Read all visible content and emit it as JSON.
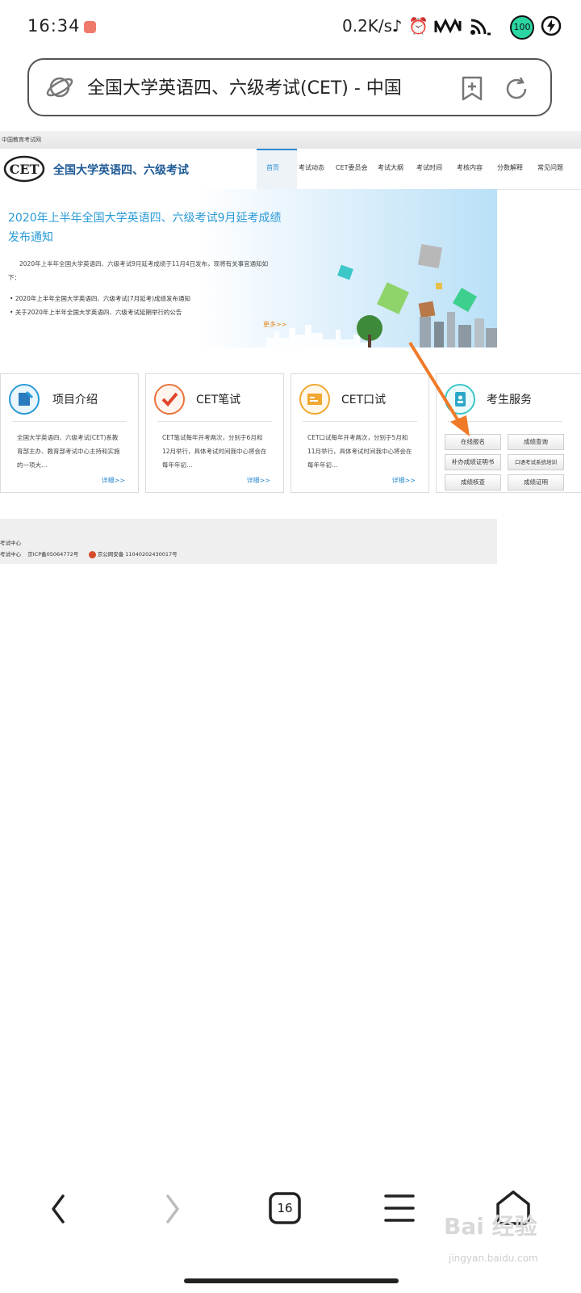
{
  "status_bar": {
    "time": "16:34",
    "net_speed": "0.2K/s",
    "battery": "100"
  },
  "browser": {
    "address_title": "全国大学英语四、六级考试(CET) - 中国",
    "tab_count": "16"
  },
  "site": {
    "top_label": "中国教育考试网",
    "logo_text": "CET",
    "logo_title": "全国大学英语四、六级考试",
    "nav": [
      "首页",
      "考试动态",
      "CET委员会",
      "考试大纲",
      "考试时间",
      "考核内容",
      "分数解释",
      "常见问题"
    ]
  },
  "banner": {
    "title": "2020年上半年全国大学英语四、六级考试9月延考成绩发布通知",
    "description": "2020年上半年全国大学英语四、六级考试9月延考成绩于11月4日发布，现将有关事宜通知如下：",
    "links": [
      "2020年上半年全国大学英语四、六级考试(7月延考)成绩发布通知",
      "关于2020年上半年全国大学英语四、六级考试延期举行的公告"
    ],
    "more": "更多>>"
  },
  "cards": [
    {
      "title": "项目介绍",
      "text": "全国大学英语四、六级考试(CET)系教育部主办、教育部考试中心主持和实施的一项大…",
      "more": "详细>>"
    },
    {
      "title": "CET笔试",
      "text": "CET笔试每年开考两次，分别于6月和12月举行，具体考试时间我中心将会在每年年初…",
      "more": "详细>>"
    },
    {
      "title": "CET口试",
      "text": "CET口试每年开考两次，分别于5月和11月举行，具体考试时间我中心将会在每年年初…",
      "more": "详细>>"
    },
    {
      "title": "考生服务"
    }
  ],
  "services": [
    "在线报名",
    "成绩查询",
    "补办成绩证明书",
    "口语考试系统培训",
    "成绩核查",
    "成绩证明"
  ],
  "footer": {
    "line1": "考试中心",
    "line2_a": "考试中心",
    "icp": "京ICP备05064772号",
    "police": "京公网安备 11040202430017号"
  },
  "watermark": {
    "text": "Bai 经验",
    "url": "jingyan.baidu.com"
  },
  "colors": {
    "brand_blue": "#1e5a96",
    "link_blue": "#2a8ad0",
    "banner_title": "#2a9ad6",
    "arrow_orange": "#f07a28",
    "battery_green": "#2bd6a3"
  },
  "icons": [
    "planet-icon",
    "bookmark-add-icon",
    "refresh-icon",
    "back-icon",
    "forward-icon",
    "tabs-icon",
    "menu-icon",
    "home-icon"
  ]
}
